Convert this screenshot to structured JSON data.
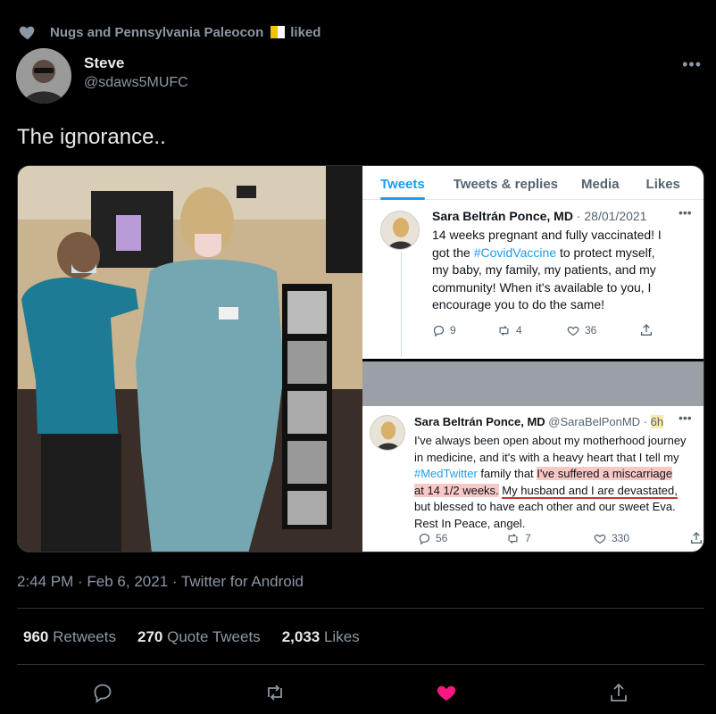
{
  "social_context": {
    "text": "Nugs and Pennsylvania Paleocon",
    "suffix": "liked",
    "icon": "heart-icon"
  },
  "author": {
    "display_name": "Steve",
    "handle": "@sdaws5MUFC"
  },
  "tweet": {
    "text": "The ignorance..",
    "timestamp": "2:44 PM · Feb 6, 2021 · Twitter for Android"
  },
  "embedded": {
    "tabs": [
      "Tweets",
      "Tweets & replies",
      "Media",
      "Likes"
    ],
    "active_tab": "Tweets",
    "post1": {
      "name": "Sara Beltrán Ponce, MD",
      "sep": " · ",
      "date": "28/01/2021",
      "line1": "14 weeks pregnant and fully vaccinated! I",
      "line2a": "got the ",
      "line2b": "#CovidVaccine",
      "line2c": " to protect myself,",
      "line3": "my baby, my family, my patients, and my",
      "line4": "community! When it's available to you, I",
      "line5": "encourage you to do the same!",
      "replies": "9",
      "retweets": "4",
      "likes": "36"
    },
    "post2": {
      "name": "Sara Beltrán Ponce, MD",
      "handle": "@SaraBelPonMD",
      "sep": " · ",
      "age": "6h",
      "line1": "I've always been open about my motherhood journey",
      "line2": "in medicine, and it's with a heavy heart that I tell my",
      "line3a": "#MedTwitter",
      "line3b": " family that ",
      "line3c": "I've suffered a miscarriage",
      "line4a": "at 14 1/2 weeks.",
      "line4b": " ",
      "line4c": "My husband and I are devastated,",
      "line5": "but blessed to have each other and our sweet Eva.",
      "line6": "Rest In Peace, angel.",
      "replies": "56",
      "retweets": "7",
      "likes": "330"
    }
  },
  "stats": {
    "retweets_count": "960",
    "retweets_label": "Retweets",
    "quotes_count": "270",
    "quotes_label": "Quote Tweets",
    "likes_count": "2,033",
    "likes_label": "Likes"
  },
  "colors": {
    "background": "#000000",
    "accent": "#1d9bf0",
    "like_active": "#f91880",
    "muted": "#8b98a5"
  }
}
